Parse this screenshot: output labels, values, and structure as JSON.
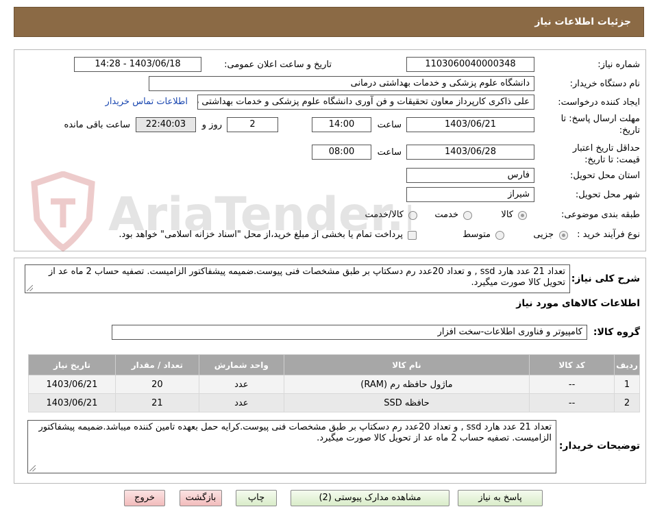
{
  "header": {
    "title": "جزئیات اطلاعات نیاز"
  },
  "form": {
    "need_number_label": "شماره نیاز:",
    "need_number": "1103060040000348",
    "announce_label": "تاریخ و ساعت اعلان عمومی:",
    "announce_value": "1403/06/18 - 14:28",
    "buyer_org_label": "نام دستگاه خریدار:",
    "buyer_org": "دانشگاه علوم پزشکی و خدمات بهداشتی درمانی",
    "creator_label": "ایجاد کننده درخواست:",
    "creator": "علی  ذاکری کارپرداز معاون تحقیقات و فن آوری دانشگاه علوم پزشکی و خدمات بهداشتی درمانی",
    "contact_link": "اطلاعات تماس خریدار",
    "deadline_label": "مهلت ارسال پاسخ: تا تاریخ:",
    "deadline_date": "1403/06/21",
    "time_label": "ساعت",
    "deadline_time": "14:00",
    "days_value": "2",
    "days_label": "روز و",
    "remaining_time": "22:40:03",
    "remaining_label": "ساعت باقی مانده",
    "validity_label": "حداقل تاریخ اعتبار قیمت: تا تاریخ:",
    "validity_date": "1403/06/28",
    "validity_time": "08:00",
    "province_label": "استان محل تحویل:",
    "province": "فارس",
    "city_label": "شهر محل تحویل:",
    "city": "شیراز",
    "category_label": "طبقه بندی موضوعی:",
    "category_options": [
      "کالا",
      "خدمت",
      "کالا/خدمت"
    ],
    "process_label": "نوع فرآیند خرید :",
    "process_options": [
      "جزیی",
      "متوسط"
    ],
    "payment_note": "پرداخت تمام یا بخشی از مبلغ خرید،از محل \"اسناد خزانه اسلامی\" خواهد بود."
  },
  "summary": {
    "label": "شرح کلی نیاز:",
    "text": "تعداد 21 عدد هارد ssd , و تعداد 20عدد رم دسکتاپ بر طبق مشخصات فنی پیوست.ضمیمه پیشفاکتور الزامیست. تصفیه حساب 2 ماه عد از تحویل کالا صورت میگیرد.",
    "goods_info_title": "اطلاعات کالاهای مورد نیاز",
    "group_label": "گروه کالا:",
    "group_value": "کامپیوتر و فناوری اطلاعات-سخت افزار"
  },
  "table": {
    "headers": [
      "ردیف",
      "کد کالا",
      "نام کالا",
      "واحد شمارش",
      "تعداد / مقدار",
      "تاریخ نیاز"
    ],
    "rows": [
      [
        "1",
        "--",
        "ماژول حافظه رم (RAM)",
        "عدد",
        "20",
        "1403/06/21"
      ],
      [
        "2",
        "--",
        "حافظه SSD",
        "عدد",
        "21",
        "1403/06/21"
      ]
    ]
  },
  "buyer_notes": {
    "label": "توضیحات خریدار:",
    "text": "تعداد 21 عدد هارد ssd , و تعداد 20عدد رم دسکتاپ بر طبق مشخصات فنی پیوست.کرایه حمل بعهده تامین کننده میباشد.ضمیمه پیشفاکتور الزامیست. تصفیه حساب 2 ماه عد از تحویل کالا صورت میگیرد."
  },
  "buttons": {
    "reply": "پاسخ به نیاز",
    "attachments": "مشاهده مدارک پیوستی (2)",
    "print": "چاپ",
    "back": "بازگشت",
    "exit": "خروج"
  },
  "watermark": {
    "text": "AriaTender.neT"
  },
  "colors": {
    "header_bg": "#8b6a45",
    "table_header": "#a7a7a7",
    "button_green": "#d9ecc9",
    "button_red": "#f2bcbc",
    "link": "#1a47b0"
  }
}
